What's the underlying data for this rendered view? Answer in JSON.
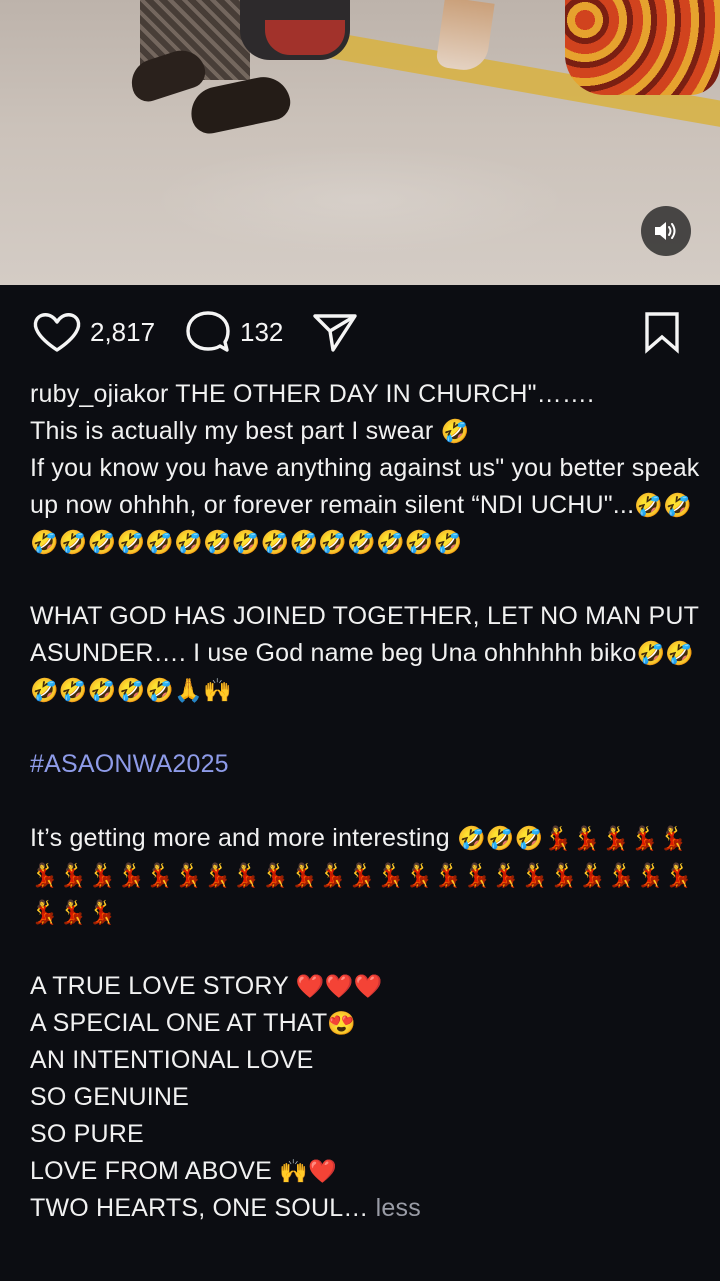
{
  "post": {
    "likes": "2,817",
    "comments": "132",
    "username": "ruby_ojiakor",
    "caption": {
      "line1_text": "THE OTHER DAY IN CHURCH\"…….",
      "line2_text": "This is actually my best part I swear",
      "line2_emoji": "🤣",
      "line3_text": "If you know you have anything against us\" you better speak up now ohhhh, or forever remain silent “NDI UCHU\"...",
      "line3_emoji": "🤣🤣🤣🤣🤣🤣🤣🤣🤣🤣🤣🤣🤣🤣🤣🤣🤣",
      "para2_text": "WHAT GOD HAS JOINED TOGETHER, LET NO MAN PUT ASUNDER…. I use God name beg Una ohhhhhh biko",
      "para2_emoji": "🤣🤣🤣🤣🤣🤣🤣🙏🙌",
      "hashtag": "#ASAONWA2025",
      "para4_text": "It’s getting more and more interesting",
      "para4_emoji": "🤣🤣🤣💃💃💃💃💃💃💃💃💃💃💃💃💃💃💃💃💃💃💃💃💃💃💃💃💃💃💃💃💃💃💃",
      "list": [
        {
          "text": "A TRUE LOVE STORY",
          "emoji": "❤️❤️❤️"
        },
        {
          "text": "A SPECIAL ONE AT THAT",
          "emoji": "😍"
        },
        {
          "text": "AN INTENTIONAL LOVE",
          "emoji": ""
        },
        {
          "text": "SO GENUINE",
          "emoji": ""
        },
        {
          "text": "SO PURE",
          "emoji": ""
        },
        {
          "text": "LOVE FROM ABOVE",
          "emoji": "🙌❤️"
        },
        {
          "text": "TWO HEARTS, ONE SOUL…",
          "emoji": ""
        }
      ],
      "less_label": "less"
    }
  },
  "icons": {
    "like": "heart-outline-icon",
    "comment": "speech-bubble-icon",
    "share": "paper-plane-icon",
    "save": "bookmark-icon",
    "mute": "speaker-icon"
  },
  "colors": {
    "background": "#0c0d12",
    "text": "#f1f1f1",
    "hashtag": "#8e9be8",
    "muted": "#9a9ca6"
  }
}
